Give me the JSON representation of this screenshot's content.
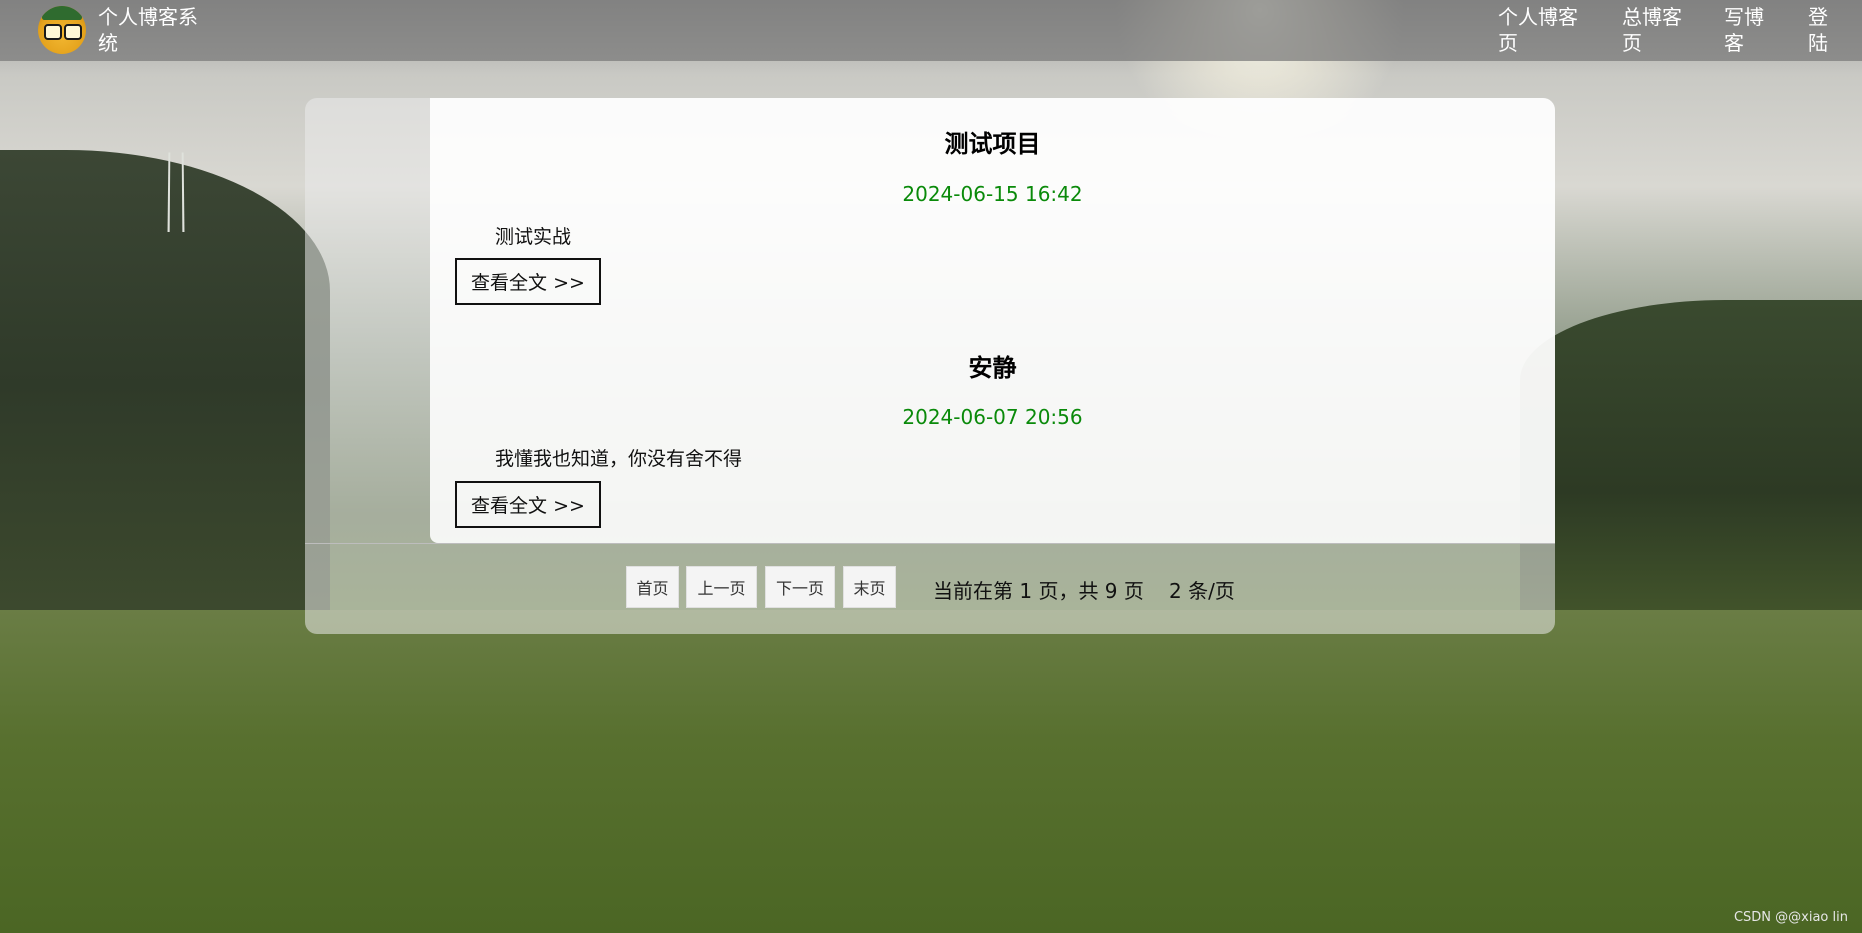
{
  "nav": {
    "brand": "个人博客系统",
    "links": [
      "个人博客页",
      "总博客页",
      "写博客",
      "登陆"
    ]
  },
  "posts": [
    {
      "title": "测试项目",
      "date": "2024-06-15 16:42",
      "desc": "测试实战",
      "read_more": "查看全文 >>"
    },
    {
      "title": "安静",
      "date": "2024-06-07 20:56",
      "desc": "我懂我也知道，你没有舍不得",
      "read_more": "查看全文 >>"
    }
  ],
  "pager": {
    "first": "首页",
    "prev": "上一页",
    "next": "下一页",
    "last": "末页",
    "info": "当前在第 1 页，共 9 页",
    "per_page": "2 条/页"
  },
  "watermark": "CSDN @@xiao lin",
  "colors": {
    "date": "#0a8a0a",
    "nav_bg": "rgba(120,120,120,0.72)"
  }
}
